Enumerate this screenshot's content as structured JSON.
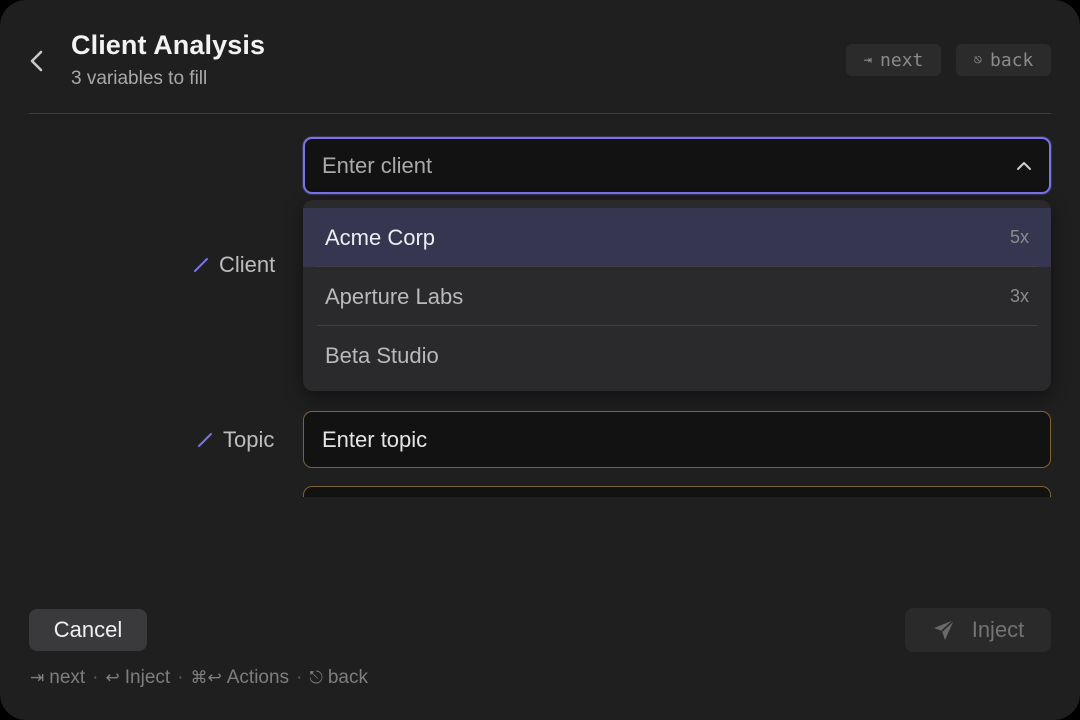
{
  "header": {
    "title": "Client Analysis",
    "subtitle": "3 variables to fill",
    "shortcut_next": {
      "glyph": "⇥",
      "label": "next"
    },
    "shortcut_back": {
      "glyph": "⎋",
      "label": "back"
    }
  },
  "fields": {
    "client": {
      "label": "Client",
      "placeholder": "Enter client",
      "dropdown_open": true,
      "options": [
        {
          "label": "Acme Corp",
          "count": "5x",
          "selected": true
        },
        {
          "label": "Aperture Labs",
          "count": "3x",
          "selected": false
        },
        {
          "label": "Beta Studio",
          "count": "",
          "selected": false
        }
      ]
    },
    "topic": {
      "label": "Topic",
      "placeholder": "Enter topic"
    }
  },
  "footer": {
    "cancel_label": "Cancel",
    "inject_label": "Inject",
    "hints": [
      {
        "symbol": "⇥",
        "text": "next"
      },
      {
        "symbol": "↩",
        "text": "Inject"
      },
      {
        "symbol": "⌘↩",
        "text": "Actions"
      },
      {
        "symbol": "⎋",
        "text": "back"
      }
    ]
  },
  "colors": {
    "accent": "#7a73e6",
    "window_bg": "#1f1f20",
    "input_border_pending": "#7d6530",
    "selected_option_bg": "#363650"
  },
  "icons": [
    "chevron-left-icon",
    "pencil-icon",
    "chevron-up-icon",
    "send-icon"
  ]
}
